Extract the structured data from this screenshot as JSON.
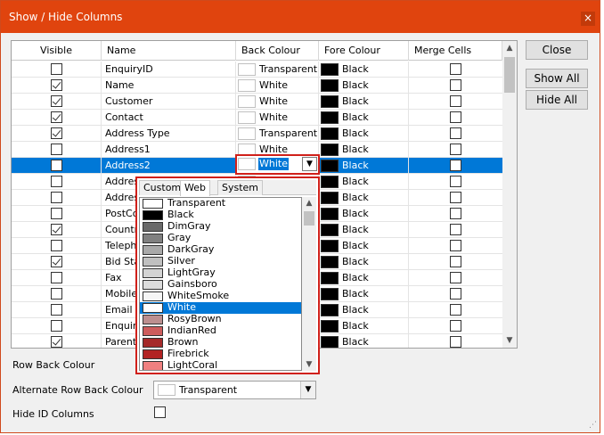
{
  "window": {
    "title": "Show / Hide Columns",
    "close_glyph": "×"
  },
  "columns": {
    "visible": "Visible",
    "name": "Name",
    "back_colour": "Back Colour",
    "fore_colour": "Fore Colour",
    "merge_cells": "Merge Cells"
  },
  "rows": [
    {
      "visible": false,
      "name": "EnquiryID",
      "back": "Transparent",
      "back_hex": "#ffffff",
      "fore": "Black",
      "fore_hex": "#000000",
      "merge": false
    },
    {
      "visible": true,
      "name": "Name",
      "back": "White",
      "back_hex": "#ffffff",
      "fore": "Black",
      "fore_hex": "#000000",
      "merge": false
    },
    {
      "visible": true,
      "name": "Customer",
      "back": "White",
      "back_hex": "#ffffff",
      "fore": "Black",
      "fore_hex": "#000000",
      "merge": false
    },
    {
      "visible": true,
      "name": "Contact",
      "back": "White",
      "back_hex": "#ffffff",
      "fore": "Black",
      "fore_hex": "#000000",
      "merge": false
    },
    {
      "visible": true,
      "name": "Address Type",
      "back": "Transparent",
      "back_hex": "#ffffff",
      "fore": "Black",
      "fore_hex": "#000000",
      "merge": false
    },
    {
      "visible": false,
      "name": "Address1",
      "back": "White",
      "back_hex": "#ffffff",
      "fore": "Black",
      "fore_hex": "#000000",
      "merge": false
    },
    {
      "visible": false,
      "name": "Address2",
      "back": "White",
      "back_hex": "#ffffff",
      "fore": "Black",
      "fore_hex": "#000000",
      "merge": false,
      "selected": true
    },
    {
      "visible": false,
      "name": "Addres",
      "back": "",
      "back_hex": "#ffffff",
      "fore": "Black",
      "fore_hex": "#000000",
      "merge": false
    },
    {
      "visible": false,
      "name": "Addres",
      "back": "",
      "back_hex": "#ffffff",
      "fore": "Black",
      "fore_hex": "#000000",
      "merge": false
    },
    {
      "visible": false,
      "name": "PostCo",
      "back": "",
      "back_hex": "#ffffff",
      "fore": "Black",
      "fore_hex": "#000000",
      "merge": false
    },
    {
      "visible": true,
      "name": "Countr",
      "back": "",
      "back_hex": "#ffffff",
      "fore": "Black",
      "fore_hex": "#000000",
      "merge": false
    },
    {
      "visible": false,
      "name": "Teleph",
      "back": "",
      "back_hex": "#ffffff",
      "fore": "Black",
      "fore_hex": "#000000",
      "merge": false
    },
    {
      "visible": true,
      "name": "Bid Sta",
      "back": "",
      "back_hex": "#ffffff",
      "fore": "Black",
      "fore_hex": "#000000",
      "merge": false
    },
    {
      "visible": false,
      "name": "Fax",
      "back": "",
      "back_hex": "#ffffff",
      "fore": "Black",
      "fore_hex": "#000000",
      "merge": false
    },
    {
      "visible": false,
      "name": "Mobile",
      "back": "",
      "back_hex": "#ffffff",
      "fore": "Black",
      "fore_hex": "#000000",
      "merge": false
    },
    {
      "visible": false,
      "name": "Email",
      "back": "",
      "back_hex": "#ffffff",
      "fore": "Black",
      "fore_hex": "#000000",
      "merge": false
    },
    {
      "visible": false,
      "name": "Enquir",
      "back": "",
      "back_hex": "#ffffff",
      "fore": "Black",
      "fore_hex": "#000000",
      "merge": false
    },
    {
      "visible": true,
      "name": "Parent",
      "back": "",
      "back_hex": "#ffffff",
      "fore": "Black",
      "fore_hex": "#000000",
      "merge": false
    }
  ],
  "buttons": {
    "close": "Close",
    "show_all": "Show All",
    "hide_all": "Hide All"
  },
  "options": {
    "row_back_colour_label": "Row Back Colour",
    "alt_row_back_colour_label": "Alternate Row Back Colour",
    "alt_row_back_colour_value": "Transparent",
    "hide_id_columns_label": "Hide ID Columns",
    "hide_id_columns_checked": false
  },
  "editor": {
    "value": "White"
  },
  "popup": {
    "tabs": [
      "Custom",
      "Web",
      "System"
    ],
    "active_tab": "Web",
    "items": [
      {
        "name": "Transparent",
        "hex": "#ffffff"
      },
      {
        "name": "Black",
        "hex": "#000000"
      },
      {
        "name": "DimGray",
        "hex": "#696969"
      },
      {
        "name": "Gray",
        "hex": "#808080"
      },
      {
        "name": "DarkGray",
        "hex": "#a9a9a9"
      },
      {
        "name": "Silver",
        "hex": "#c0c0c0"
      },
      {
        "name": "LightGray",
        "hex": "#d3d3d3"
      },
      {
        "name": "Gainsboro",
        "hex": "#dcdcdc"
      },
      {
        "name": "WhiteSmoke",
        "hex": "#f5f5f5"
      },
      {
        "name": "White",
        "hex": "#ffffff",
        "selected": true
      },
      {
        "name": "RosyBrown",
        "hex": "#bc8f8f"
      },
      {
        "name": "IndianRed",
        "hex": "#cd5c5c"
      },
      {
        "name": "Brown",
        "hex": "#a52a2a"
      },
      {
        "name": "Firebrick",
        "hex": "#b22222"
      },
      {
        "name": "LightCoral",
        "hex": "#f08080"
      }
    ]
  },
  "colors": {
    "titlebar": "#e0440e",
    "selection": "#0078d7",
    "highlight_border": "#d0201a"
  }
}
